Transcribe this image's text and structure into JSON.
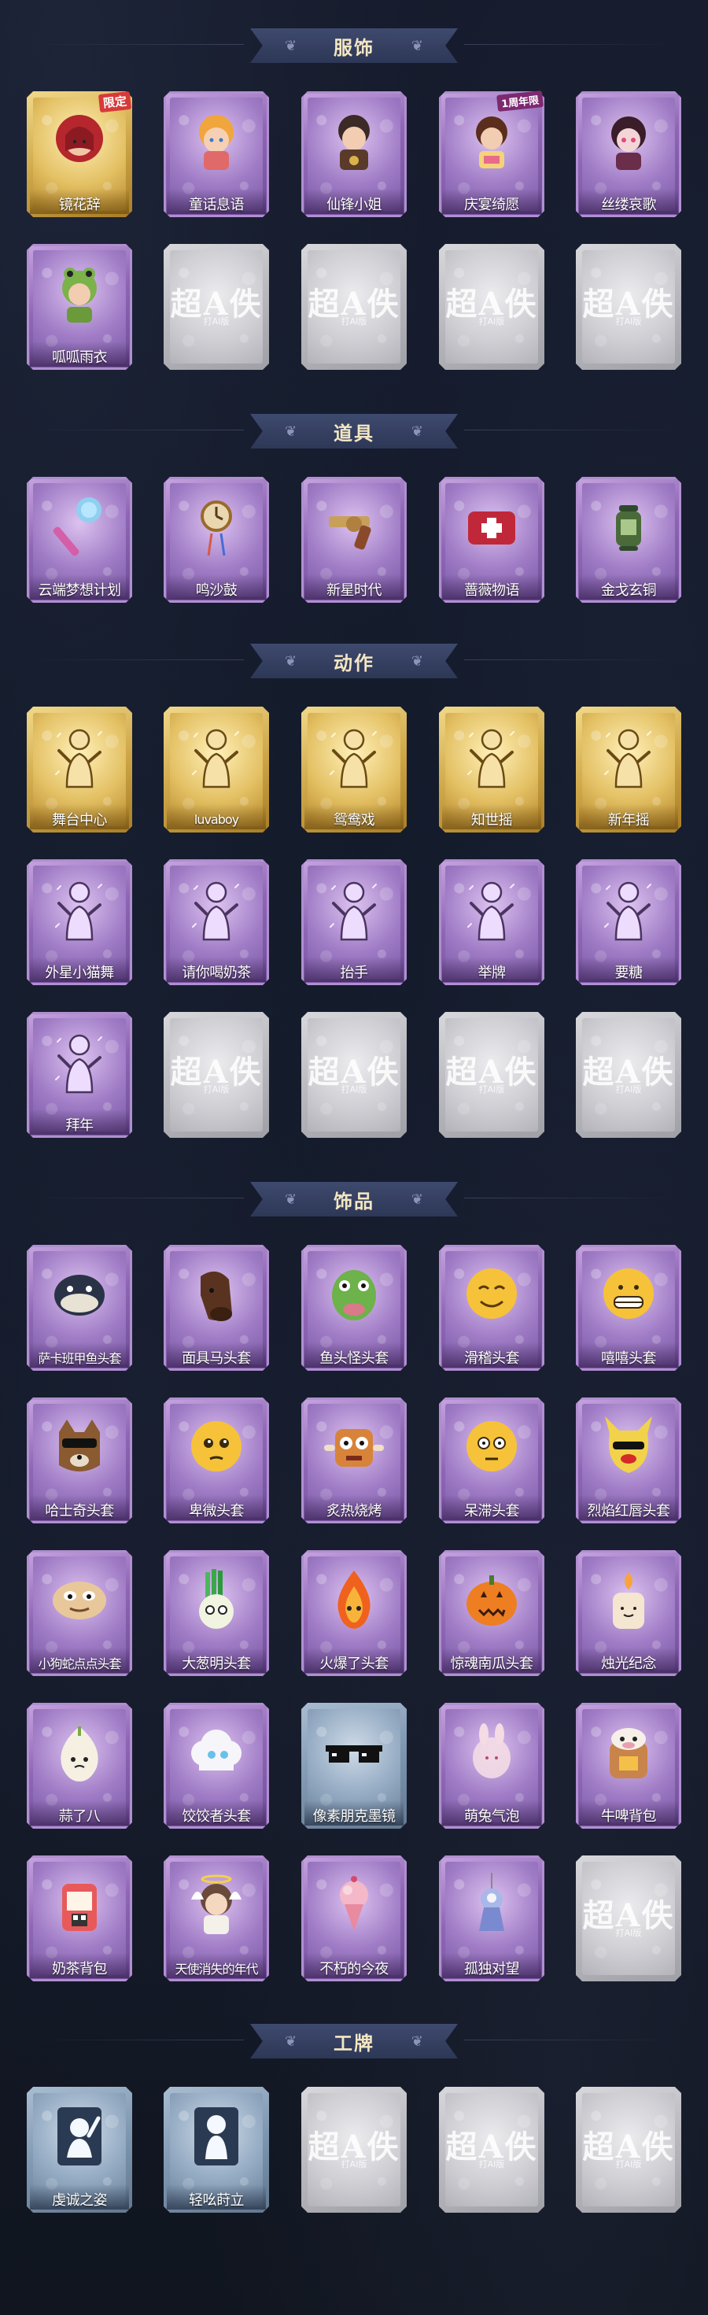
{
  "sections": [
    {
      "title": "服饰",
      "items": [
        {
          "label": "镜花辞",
          "rarity": "gold",
          "icon": "costume-red-hood",
          "badge": "限定"
        },
        {
          "label": "童话息语",
          "rarity": "purple",
          "icon": "costume-fairytale-girl"
        },
        {
          "label": "仙锋小姐",
          "rarity": "purple",
          "icon": "costume-miss-sennin"
        },
        {
          "label": "庆宴绮愿",
          "rarity": "purple",
          "icon": "costume-feast-wish",
          "badge": "1周年限"
        },
        {
          "label": "丝缕哀歌",
          "rarity": "purple",
          "icon": "costume-silk-elegy"
        },
        {
          "label": "呱呱雨衣",
          "rarity": "purple",
          "icon": "costume-frog-raincoat"
        },
        {
          "label": "",
          "rarity": "gray",
          "icon": "placeholder-logo"
        },
        {
          "label": "",
          "rarity": "gray",
          "icon": "placeholder-logo"
        },
        {
          "label": "",
          "rarity": "gray",
          "icon": "placeholder-logo"
        },
        {
          "label": "",
          "rarity": "gray",
          "icon": "placeholder-logo"
        }
      ]
    },
    {
      "title": "道具",
      "items": [
        {
          "label": "云端梦想计划",
          "rarity": "purple",
          "icon": "microphone-wand"
        },
        {
          "label": "鸣沙鼓",
          "rarity": "purple",
          "icon": "sand-drum-clock"
        },
        {
          "label": "新星时代",
          "rarity": "purple",
          "icon": "revolver"
        },
        {
          "label": "蔷薇物语",
          "rarity": "purple",
          "icon": "medical-kit"
        },
        {
          "label": "金戈玄铜",
          "rarity": "purple",
          "icon": "lantern"
        }
      ]
    },
    {
      "title": "动作",
      "items": [
        {
          "label": "舞台中心",
          "rarity": "gold",
          "icon": "pose-stage-center"
        },
        {
          "label": "luvaboy",
          "rarity": "gold",
          "icon": "pose-luvaboy"
        },
        {
          "label": "鸳鸯戏",
          "rarity": "gold",
          "icon": "pose-mandarin-duck"
        },
        {
          "label": "知世摇",
          "rarity": "gold",
          "icon": "pose-shake"
        },
        {
          "label": "新年摇",
          "rarity": "gold",
          "icon": "pose-new-year-shake"
        },
        {
          "label": "外星小猫舞",
          "rarity": "purple",
          "icon": "pose-alien-cat"
        },
        {
          "label": "请你喝奶茶",
          "rarity": "purple",
          "icon": "pose-milk-tea"
        },
        {
          "label": "抬手",
          "rarity": "purple",
          "icon": "pose-raise-hand"
        },
        {
          "label": "举牌",
          "rarity": "purple",
          "icon": "pose-hold-sign"
        },
        {
          "label": "要糖",
          "rarity": "purple",
          "icon": "pose-ask-candy"
        },
        {
          "label": "拜年",
          "rarity": "purple",
          "icon": "pose-new-year-greeting"
        },
        {
          "label": "",
          "rarity": "gray",
          "icon": "placeholder-logo"
        },
        {
          "label": "",
          "rarity": "gray",
          "icon": "placeholder-logo"
        },
        {
          "label": "",
          "rarity": "gray",
          "icon": "placeholder-logo"
        },
        {
          "label": "",
          "rarity": "gray",
          "icon": "placeholder-logo"
        }
      ]
    },
    {
      "title": "饰品",
      "items": [
        {
          "label": "萨卡班甲鱼头套",
          "rarity": "purple",
          "icon": "fish-head-mask"
        },
        {
          "label": "面具马头套",
          "rarity": "purple",
          "icon": "horse-head-mask"
        },
        {
          "label": "鱼头怪头套",
          "rarity": "purple",
          "icon": "fish-monster-mask"
        },
        {
          "label": "滑稽头套",
          "rarity": "purple",
          "icon": "funny-emoji-mask"
        },
        {
          "label": "嘻嘻头套",
          "rarity": "purple",
          "icon": "grin-emoji-mask"
        },
        {
          "label": "哈士奇头套",
          "rarity": "purple",
          "icon": "husky-sunglasses-mask"
        },
        {
          "label": "卑微头套",
          "rarity": "purple",
          "icon": "pleading-emoji-mask"
        },
        {
          "label": "炙热烧烤",
          "rarity": "purple",
          "icon": "bbq-mask"
        },
        {
          "label": "呆滞头套",
          "rarity": "purple",
          "icon": "dazed-emoji-mask"
        },
        {
          "label": "烈焰红唇头套",
          "rarity": "purple",
          "icon": "red-lips-pikachu-mask"
        },
        {
          "label": "小狗蛇点点头套",
          "rarity": "purple",
          "icon": "puppy-snake-mask"
        },
        {
          "label": "大葱明头套",
          "rarity": "purple",
          "icon": "scallion-mask"
        },
        {
          "label": "火爆了头套",
          "rarity": "purple",
          "icon": "fire-mask"
        },
        {
          "label": "惊魂南瓜头套",
          "rarity": "purple",
          "icon": "pumpkin-mask"
        },
        {
          "label": "烛光纪念",
          "rarity": "purple",
          "icon": "candle-mask"
        },
        {
          "label": "蒜了八",
          "rarity": "purple",
          "icon": "garlic-mask"
        },
        {
          "label": "饺饺者头套",
          "rarity": "purple",
          "icon": "dumpling-cloud-mask"
        },
        {
          "label": "像素朋克墨镜",
          "rarity": "blue",
          "icon": "pixel-sunglasses"
        },
        {
          "label": "萌兔气泡",
          "rarity": "purple",
          "icon": "bunny-bubble"
        },
        {
          "label": "牛啤背包",
          "rarity": "purple",
          "icon": "cow-beer-backpack"
        },
        {
          "label": "奶茶背包",
          "rarity": "purple",
          "icon": "milk-tea-backpack"
        },
        {
          "label": "天使消失的年代",
          "rarity": "purple",
          "icon": "angel-girl"
        },
        {
          "label": "不朽的今夜",
          "rarity": "purple",
          "icon": "ice-cream-pendant"
        },
        {
          "label": "孤独对望",
          "rarity": "purple",
          "icon": "lonely-pendant"
        },
        {
          "label": "",
          "rarity": "gray",
          "icon": "placeholder-logo"
        }
      ]
    },
    {
      "title": "工牌",
      "items": [
        {
          "label": "虔诚之姿",
          "rarity": "blue",
          "icon": "badge-pious-pose"
        },
        {
          "label": "轻吆莳立",
          "rarity": "blue",
          "icon": "badge-stand"
        },
        {
          "label": "",
          "rarity": "gray",
          "icon": "placeholder-logo"
        },
        {
          "label": "",
          "rarity": "gray",
          "icon": "placeholder-logo"
        },
        {
          "label": "",
          "rarity": "gray",
          "icon": "placeholder-logo"
        }
      ]
    }
  ],
  "placeholder": {
    "logo_text": "超A佚",
    "sub_text": "打AI版"
  },
  "colors": {
    "background": "#141a29",
    "banner": "#36415f",
    "banner_text": "#f3e6c2",
    "purple": "#9a74c2",
    "gold": "#d4ae52",
    "gray": "#bdbdc3",
    "blue": "#8ca2ba"
  }
}
